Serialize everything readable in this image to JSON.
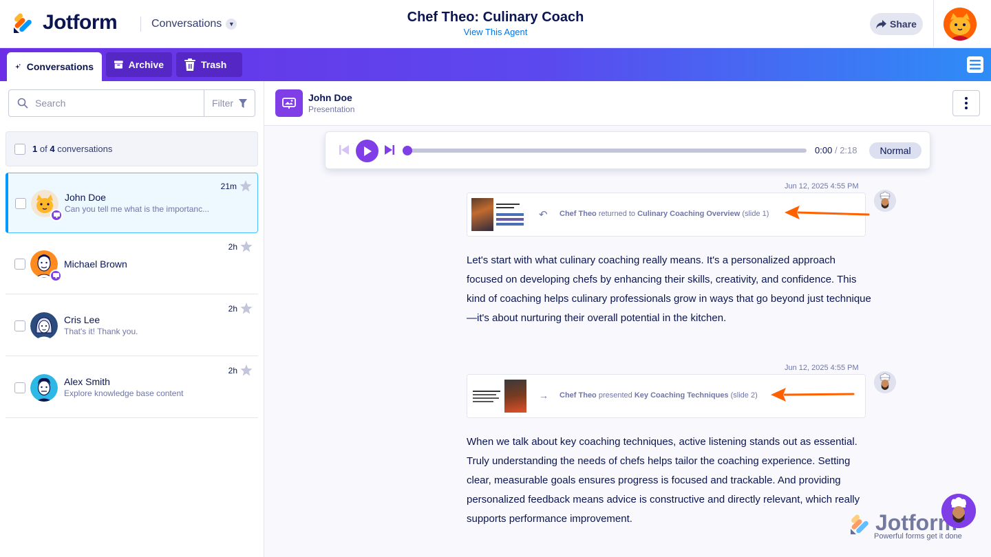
{
  "header": {
    "brand": "Jotform",
    "section": "Conversations",
    "agent_title": "Chef Theo: Culinary Coach",
    "view_link": "View This Agent",
    "share_label": "Share"
  },
  "tabs": {
    "conversations": "Conversations",
    "archive": "Archive",
    "trash": "Trash"
  },
  "sidebar": {
    "search_placeholder": "Search",
    "filter_label": "Filter",
    "count_selected": "1",
    "count_of": "of",
    "count_total": "4",
    "count_suffix": "conversations",
    "conversations": [
      {
        "name": "John Doe",
        "preview": "Can you tell me what is the importanc...",
        "time": "21m"
      },
      {
        "name": "Michael Brown",
        "preview": "",
        "time": "2h"
      },
      {
        "name": "Cris Lee",
        "preview": "That's it! Thank you.",
        "time": "2h"
      },
      {
        "name": "Alex Smith",
        "preview": "Explore knowledge base content",
        "time": "2h"
      }
    ]
  },
  "main": {
    "user_name": "John Doe",
    "user_sub": "Presentation",
    "player": {
      "current": "0:00",
      "separator": "/",
      "duration": "2:18",
      "speed": "Normal",
      "progress": 0
    },
    "events": [
      {
        "timestamp": "Jun 12, 2025 4:55 PM",
        "actor": "Chef Theo",
        "action": "returned to",
        "slide_title": "Culinary Coaching Overview",
        "slide_ref": "(slide 1)"
      },
      {
        "timestamp": "Jun 12, 2025 4:55 PM",
        "actor": "Chef Theo",
        "action": "presented",
        "slide_title": "Key Coaching Techniques",
        "slide_ref": "(slide 2)"
      }
    ],
    "messages": [
      "Let's start with what culinary coaching really means. It's a personalized approach focused on developing chefs by enhancing their skills, creativity, and confidence. This kind of coaching helps culinary professionals grow in ways that go beyond just technique—it's about nurturing their overall potential in the kitchen.",
      "When we talk about key coaching techniques, active listening stands out as essential. Truly understanding the needs of chefs helps tailor the coaching experience. Setting clear, measurable goals ensures progress is focused and trackable. And providing personalized feedback means advice is constructive and directly relevant, which really supports performance improvement."
    ]
  },
  "watermark": {
    "brand": "Jotform",
    "tagline": "Powerful forms get it done"
  },
  "colors": {
    "primary": "#7f3ee6",
    "navy": "#0a1551",
    "link": "#0075e3",
    "active_border": "#0099ff",
    "arrow": "#ff6100"
  }
}
